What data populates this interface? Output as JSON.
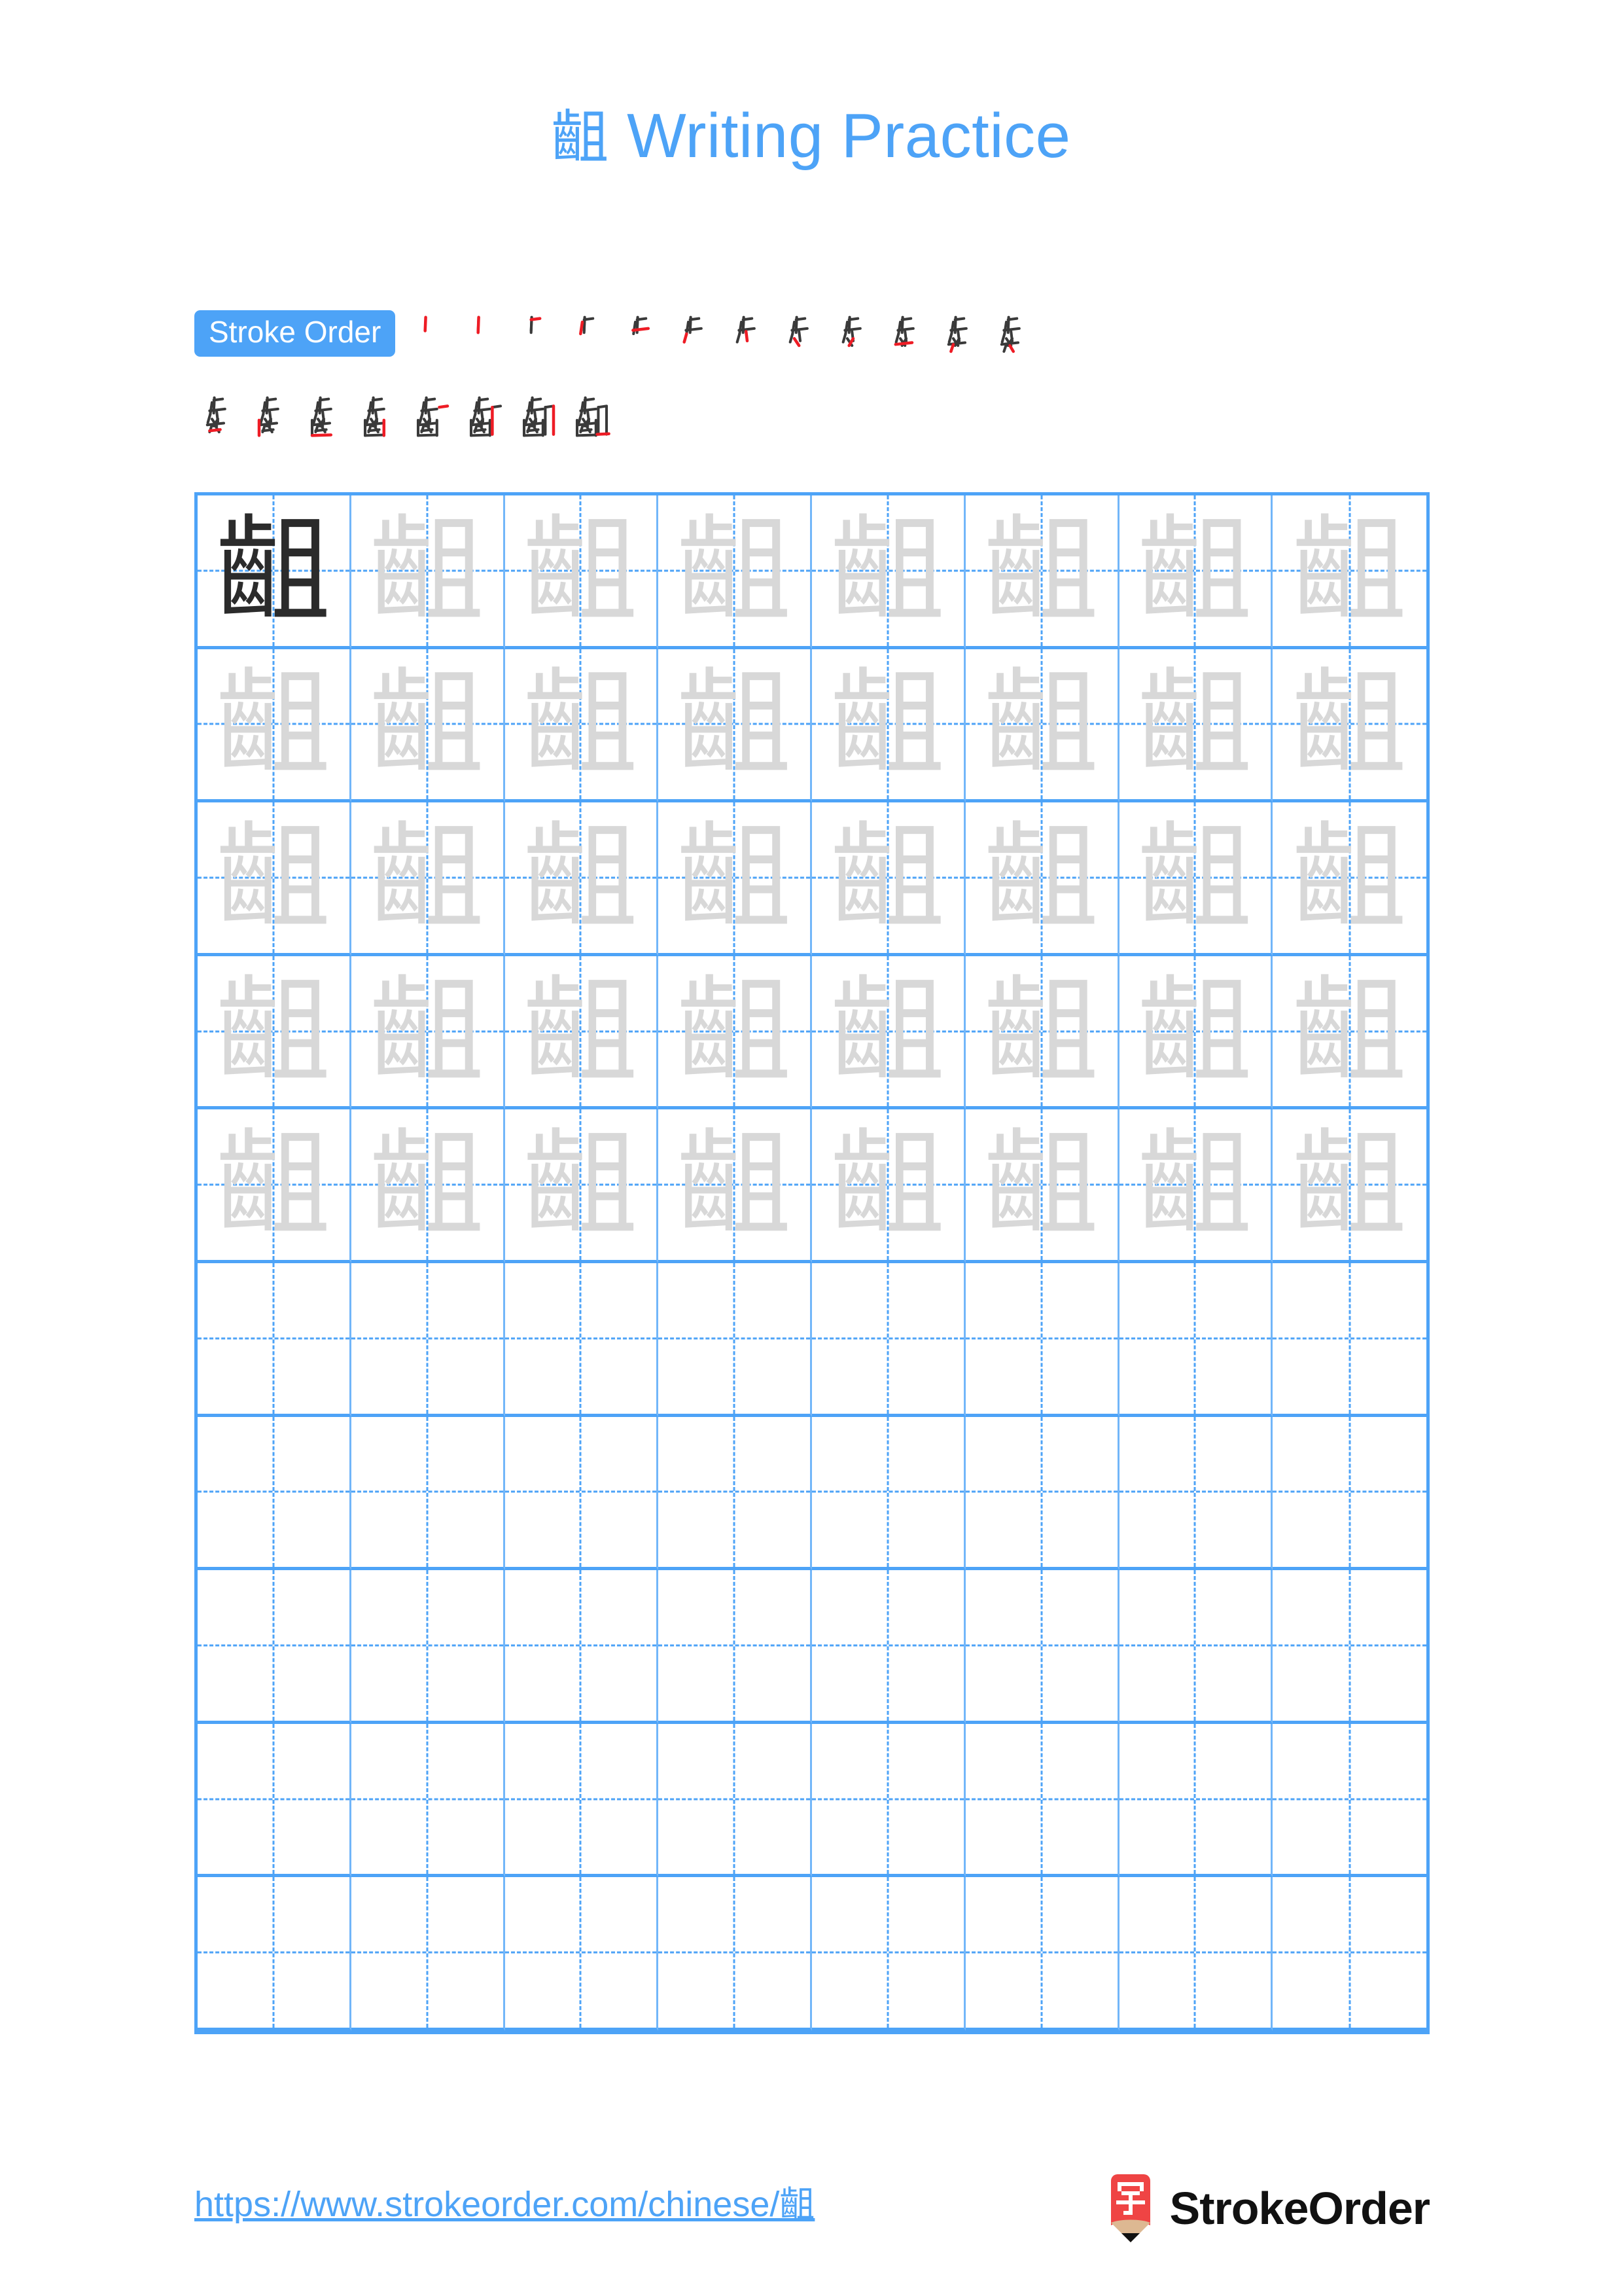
{
  "character": "齟",
  "title": {
    "character": "齟",
    "text": "Writing Practice",
    "full": "齟 Writing Practice",
    "color": "#4da3f7"
  },
  "stroke_order": {
    "badge_label": "Stroke Order",
    "badge_bg": "#4da3f7",
    "badge_text_color": "#ffffff",
    "total_strokes": 20,
    "new_stroke_color": "#ee1c25",
    "existing_stroke_color": "#3a3a3a",
    "row1_count": 12,
    "row2_count": 8,
    "steps": [
      {
        "index": 1,
        "glyph": "丨"
      },
      {
        "index": 2,
        "glyph": "ᐟ"
      },
      {
        "index": 3,
        "glyph": "止"
      },
      {
        "index": 4,
        "glyph": "止"
      },
      {
        "index": 5,
        "glyph": "止"
      },
      {
        "index": 6,
        "glyph": "止"
      },
      {
        "index": 7,
        "glyph": "歨"
      },
      {
        "index": 8,
        "glyph": "歨"
      },
      {
        "index": 9,
        "glyph": "歨"
      },
      {
        "index": 10,
        "glyph": "歨"
      },
      {
        "index": 11,
        "glyph": "歨"
      },
      {
        "index": 12,
        "glyph": "歨"
      },
      {
        "index": 13,
        "glyph": "歨"
      },
      {
        "index": 14,
        "glyph": "齒"
      },
      {
        "index": 15,
        "glyph": "齒"
      },
      {
        "index": 16,
        "glyph": "齒"
      },
      {
        "index": 17,
        "glyph": "齟"
      },
      {
        "index": 18,
        "glyph": "齟"
      },
      {
        "index": 19,
        "glyph": "齟"
      },
      {
        "index": 20,
        "glyph": "齟"
      }
    ]
  },
  "grid": {
    "columns": 8,
    "rows": 10,
    "border_color": "#4da3f7",
    "inner_line_color": "#72b6f9",
    "guide_color": "#4da3f7",
    "model_char_color": "#2b2b2b",
    "trace_char_color": "#d8d8d8",
    "model_cells": 1,
    "trace_cells": 39,
    "blank_rows": 5,
    "cells": [
      "model",
      "trace",
      "trace",
      "trace",
      "trace",
      "trace",
      "trace",
      "trace",
      "trace",
      "trace",
      "trace",
      "trace",
      "trace",
      "trace",
      "trace",
      "trace",
      "trace",
      "trace",
      "trace",
      "trace",
      "trace",
      "trace",
      "trace",
      "trace",
      "trace",
      "trace",
      "trace",
      "trace",
      "trace",
      "trace",
      "trace",
      "trace",
      "trace",
      "trace",
      "trace",
      "trace",
      "trace",
      "trace",
      "trace",
      "trace",
      "blank",
      "blank",
      "blank",
      "blank",
      "blank",
      "blank",
      "blank",
      "blank",
      "blank",
      "blank",
      "blank",
      "blank",
      "blank",
      "blank",
      "blank",
      "blank",
      "blank",
      "blank",
      "blank",
      "blank",
      "blank",
      "blank",
      "blank",
      "blank",
      "blank",
      "blank",
      "blank",
      "blank",
      "blank",
      "blank",
      "blank",
      "blank",
      "blank",
      "blank",
      "blank",
      "blank",
      "blank",
      "blank",
      "blank",
      "blank"
    ]
  },
  "footer": {
    "url": "https://www.strokeorder.com/chinese/齟",
    "url_color": "#4da3f7",
    "brand_name": "StrokeOrder",
    "brand_color": "#111111",
    "logo_char": "字",
    "logo_body_color": "#ef4444",
    "logo_tip_color": "#ddb892"
  }
}
